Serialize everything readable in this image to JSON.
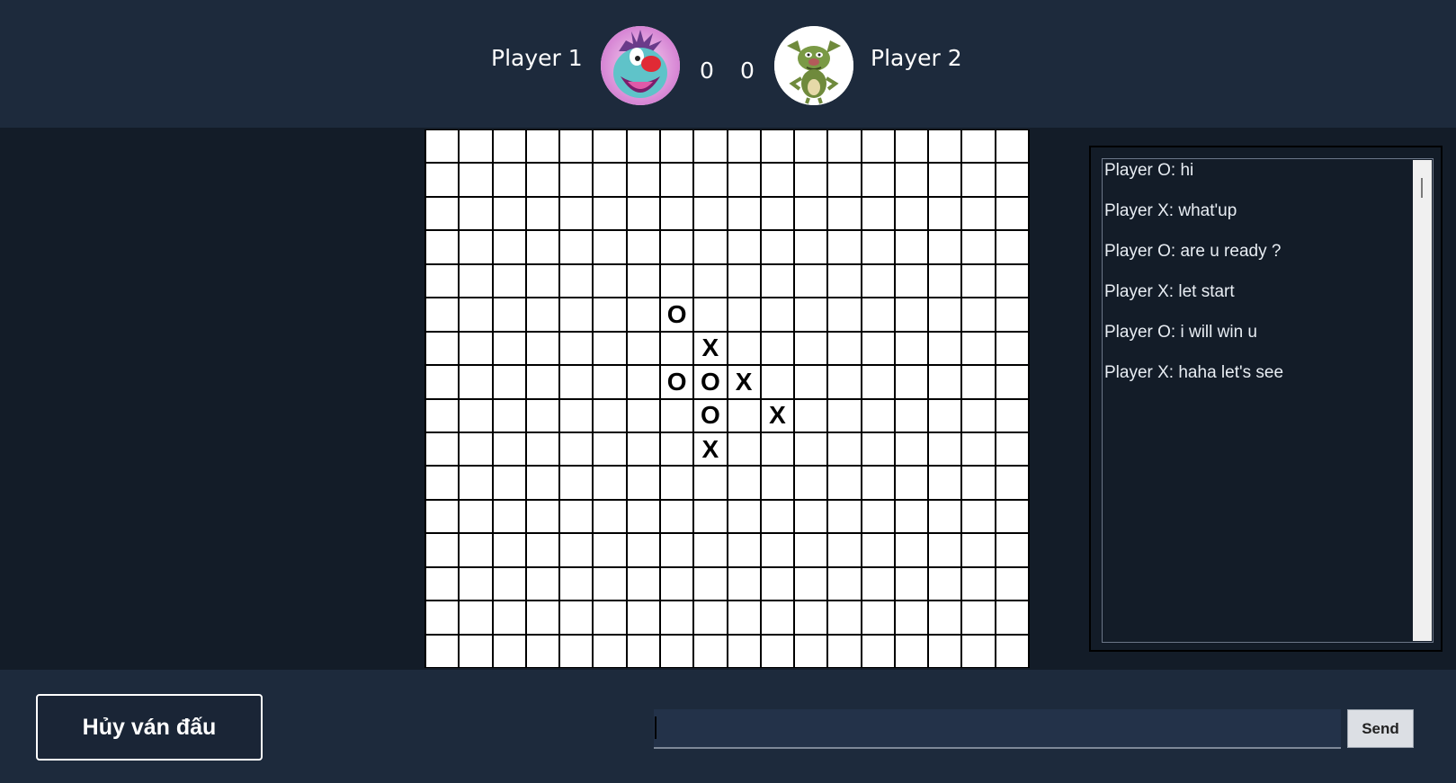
{
  "header": {
    "player1_name": "Player 1",
    "player2_name": "Player 2",
    "player1_score": "0",
    "player2_score": "0",
    "player1_avatar": "oggy-cat-avatar",
    "player2_avatar": "cockroach-avatar"
  },
  "board": {
    "cols": 18,
    "rows": 16,
    "moves": [
      {
        "row": 5,
        "col": 7,
        "mark": "O"
      },
      {
        "row": 6,
        "col": 8,
        "mark": "X"
      },
      {
        "row": 7,
        "col": 7,
        "mark": "O"
      },
      {
        "row": 7,
        "col": 8,
        "mark": "O"
      },
      {
        "row": 7,
        "col": 9,
        "mark": "X"
      },
      {
        "row": 8,
        "col": 8,
        "mark": "O"
      },
      {
        "row": 8,
        "col": 10,
        "mark": "X"
      },
      {
        "row": 9,
        "col": 8,
        "mark": "X"
      }
    ]
  },
  "chat": {
    "messages": [
      "Player O: hi",
      "Player X: what'up",
      "Player O: are u ready ?",
      "Player X: let start",
      "Player O: i will win u",
      "Player X: haha let's see"
    ],
    "input_value": "",
    "send_label": "Send"
  },
  "footer": {
    "cancel_label": "Hủy ván đấu"
  },
  "colors": {
    "header_bg": "#1d2a3c",
    "main_bg": "#131c28",
    "board_line": "#000000",
    "cell_bg": "#ffffff"
  }
}
